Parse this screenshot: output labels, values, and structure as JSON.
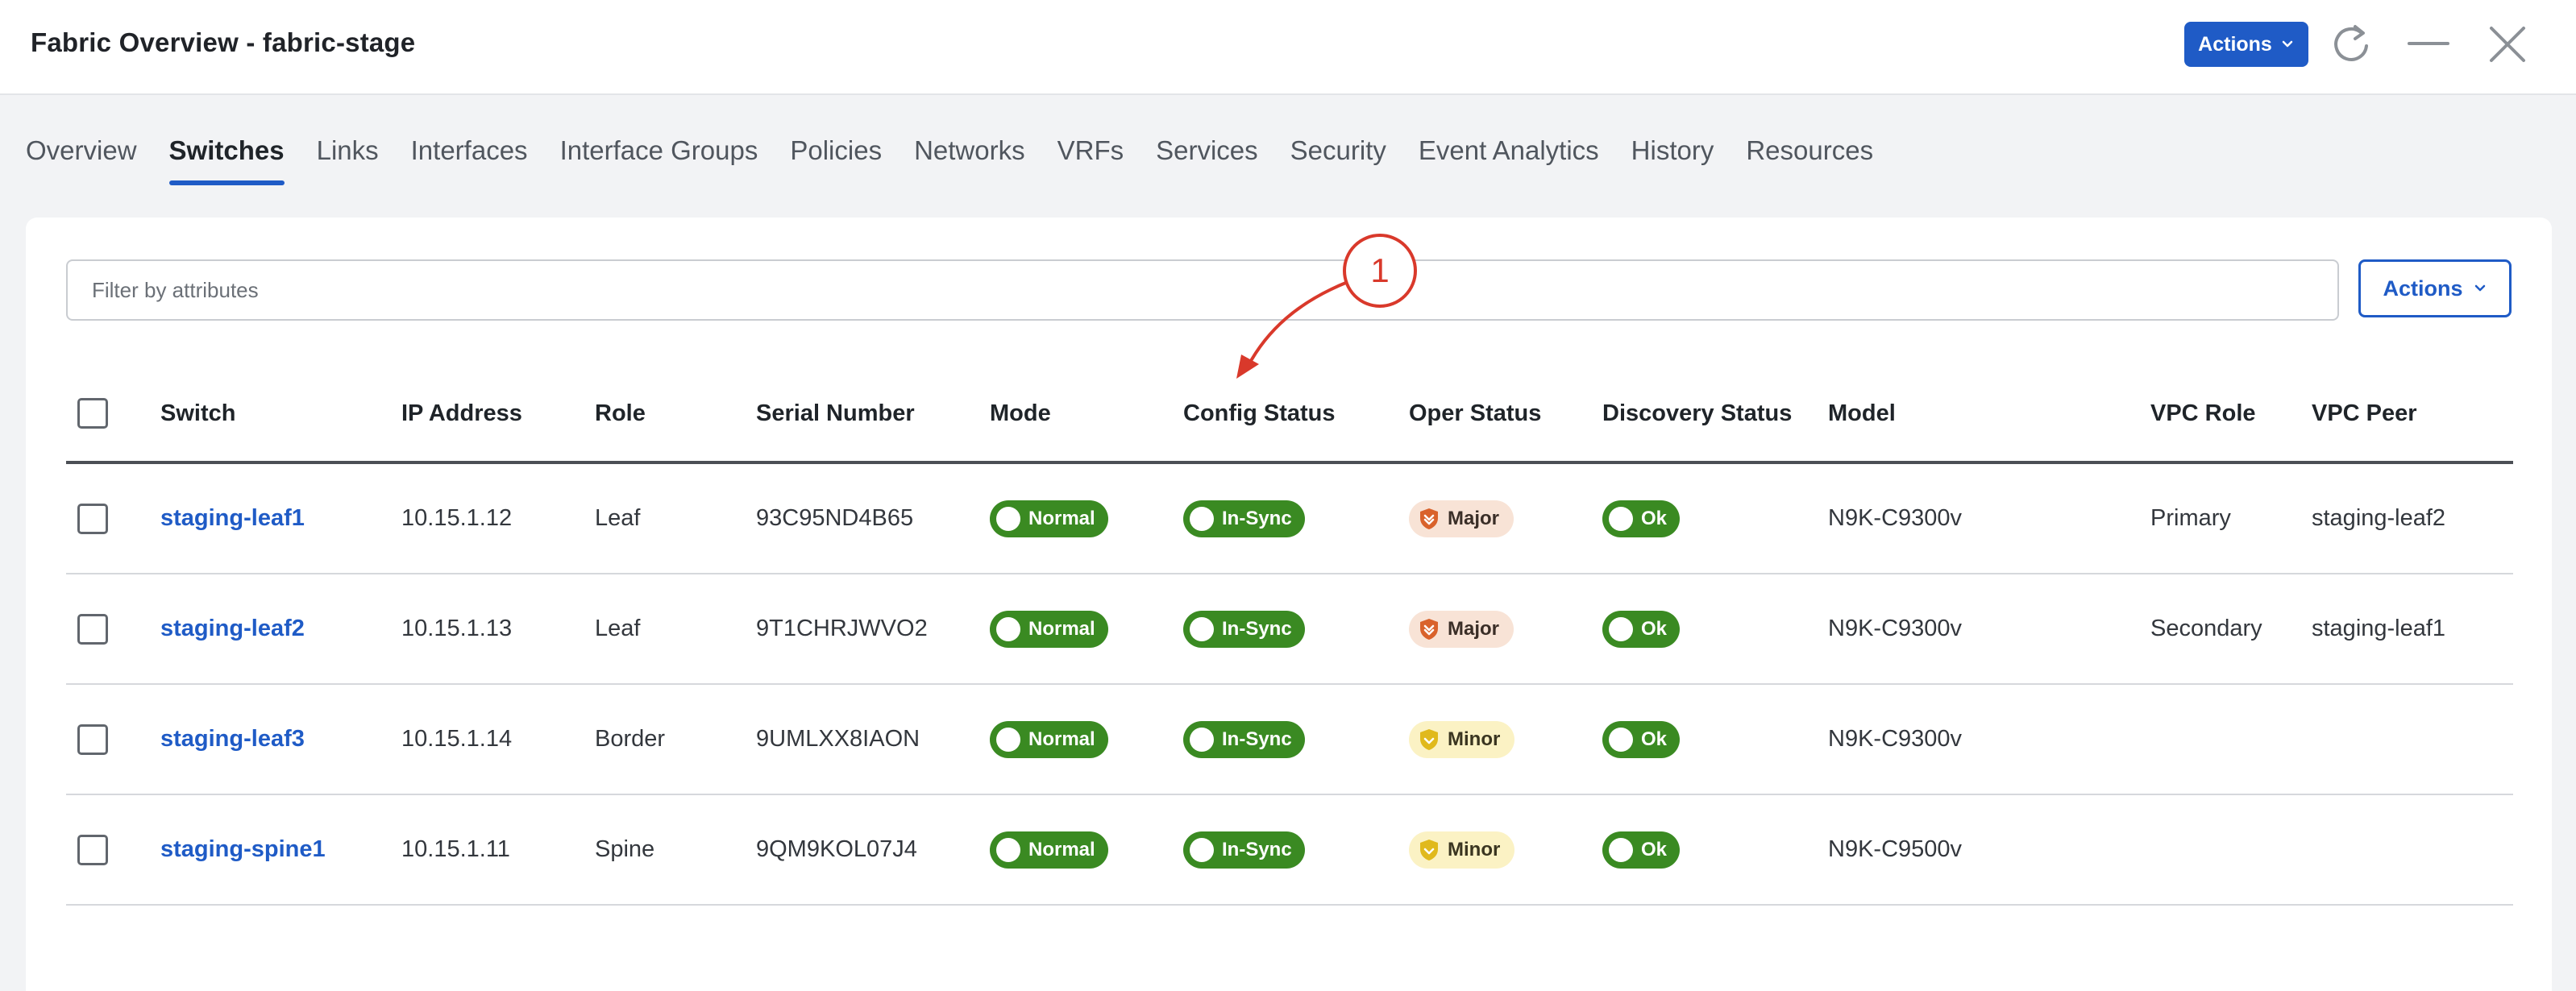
{
  "header": {
    "title": "Fabric Overview - fabric-stage",
    "actions_label": "Actions"
  },
  "tabs": [
    {
      "label": "Overview"
    },
    {
      "label": "Switches",
      "active": true
    },
    {
      "label": "Links"
    },
    {
      "label": "Interfaces"
    },
    {
      "label": "Interface Groups"
    },
    {
      "label": "Policies"
    },
    {
      "label": "Networks"
    },
    {
      "label": "VRFs"
    },
    {
      "label": "Services"
    },
    {
      "label": "Security"
    },
    {
      "label": "Event Analytics"
    },
    {
      "label": "History"
    },
    {
      "label": "Resources"
    }
  ],
  "filter": {
    "placeholder": "Filter by attributes",
    "value": ""
  },
  "card_actions_label": "Actions",
  "callout_label": "1",
  "table": {
    "columns": [
      "Switch",
      "IP Address",
      "Role",
      "Serial Number",
      "Mode",
      "Config Status",
      "Oper Status",
      "Discovery Status",
      "Model",
      "VPC Role",
      "VPC Peer"
    ],
    "rows": [
      {
        "switch": "staging-leaf1",
        "ip": "10.15.1.12",
        "role": "Leaf",
        "serial": "93C95ND4B65",
        "mode": "Normal",
        "config": "In-Sync",
        "oper": "Major",
        "discovery": "Ok",
        "model": "N9K-C9300v",
        "vpc_role": "Primary",
        "vpc_peer": "staging-leaf2"
      },
      {
        "switch": "staging-leaf2",
        "ip": "10.15.1.13",
        "role": "Leaf",
        "serial": "9T1CHRJWVO2",
        "mode": "Normal",
        "config": "In-Sync",
        "oper": "Major",
        "discovery": "Ok",
        "model": "N9K-C9300v",
        "vpc_role": "Secondary",
        "vpc_peer": "staging-leaf1"
      },
      {
        "switch": "staging-leaf3",
        "ip": "10.15.1.14",
        "role": "Border",
        "serial": "9UMLXX8IAON",
        "mode": "Normal",
        "config": "In-Sync",
        "oper": "Minor",
        "discovery": "Ok",
        "model": "N9K-C9300v",
        "vpc_role": "",
        "vpc_peer": ""
      },
      {
        "switch": "staging-spine1",
        "ip": "10.15.1.11",
        "role": "Spine",
        "serial": "9QM9KOL07J4",
        "mode": "Normal",
        "config": "In-Sync",
        "oper": "Minor",
        "discovery": "Ok",
        "model": "N9K-C9500v",
        "vpc_role": "",
        "vpc_peer": ""
      }
    ]
  },
  "colors": {
    "accent": "#1f5bc6",
    "status_green": "#3a8a22",
    "major_bg": "#f8e3d6",
    "major_icon": "#d9622b",
    "minor_bg": "#fbf2c4",
    "minor_icon": "#e0b91c",
    "callout": "#d9392b"
  }
}
